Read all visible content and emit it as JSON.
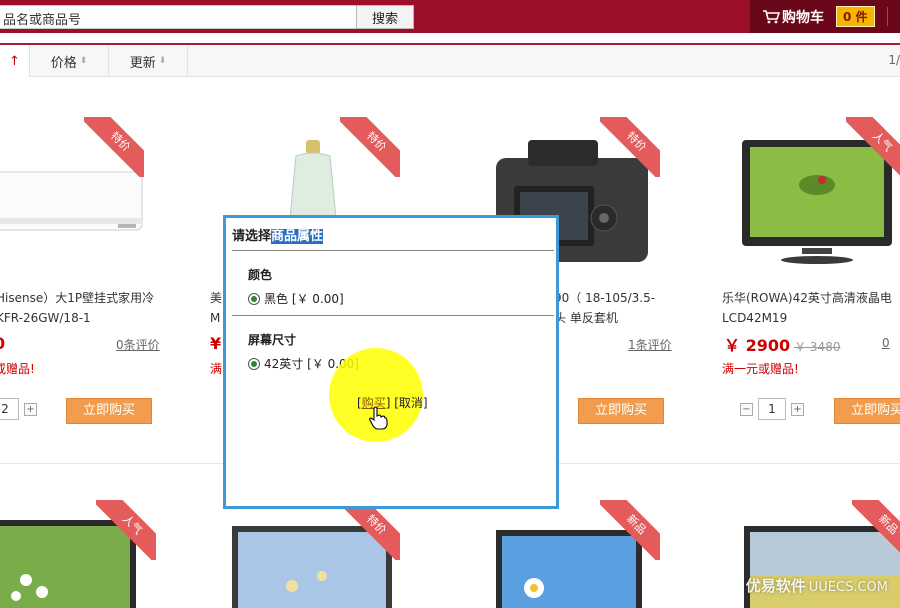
{
  "search": {
    "value": "品名或商品号",
    "button": "搜索"
  },
  "cart": {
    "label": "购物车",
    "count": "0 件"
  },
  "sortbar": {
    "first_arrow": "↑",
    "price": "价格",
    "update": "更新",
    "page_indicator": "1/"
  },
  "products": [
    {
      "name_line1": "Hisense）大1P壁挂式家用冷",
      "name_line2": "KFR-26GW/18-1",
      "price": "0",
      "reviews": "0条评价",
      "promo": "或赠品!",
      "qty": "2",
      "buy": "立即购买",
      "badge": "特价"
    },
    {
      "name_line1": "美",
      "name_line2": "M",
      "price": "¥",
      "promo": "满",
      "badge": "特价"
    },
    {
      "name_line1": "90（ 18-105/3.5-",
      "name_line2": "头 单反套机",
      "reviews": "1条评价",
      "buy": "立即购买",
      "badge": "特价"
    },
    {
      "name_line1": "乐华(ROWA)42英寸高清液晶电",
      "name_line2": "LCD42M19",
      "price": "￥ 2900",
      "old_price": "￥ 3480",
      "reviews": "0",
      "promo": "满一元或赠品!",
      "qty": "1",
      "buy": "立即购买",
      "badge": "人气"
    }
  ],
  "row2_badges": [
    "人气",
    "特价",
    "新品",
    "新品"
  ],
  "dialog": {
    "title_prefix": "请选择",
    "title_selected": "商品属性",
    "attr1_title": "颜色",
    "attr1_option": "黑色 [￥ 0.00]",
    "attr2_title": "屏幕尺寸",
    "attr2_option": "42英寸 [￥ 0.00]",
    "buy": "购买",
    "cancel": "取消",
    "bracket_open": "[",
    "bracket_mid": "] [",
    "bracket_close": "]"
  },
  "watermark": {
    "brand": "优易软件",
    "site": "UUECS.COM"
  },
  "colors": {
    "topbar": "#9b0f2b",
    "dialog_border": "#3d9ad6",
    "price": "#cc0000",
    "buy_button": "#f29c4d"
  }
}
